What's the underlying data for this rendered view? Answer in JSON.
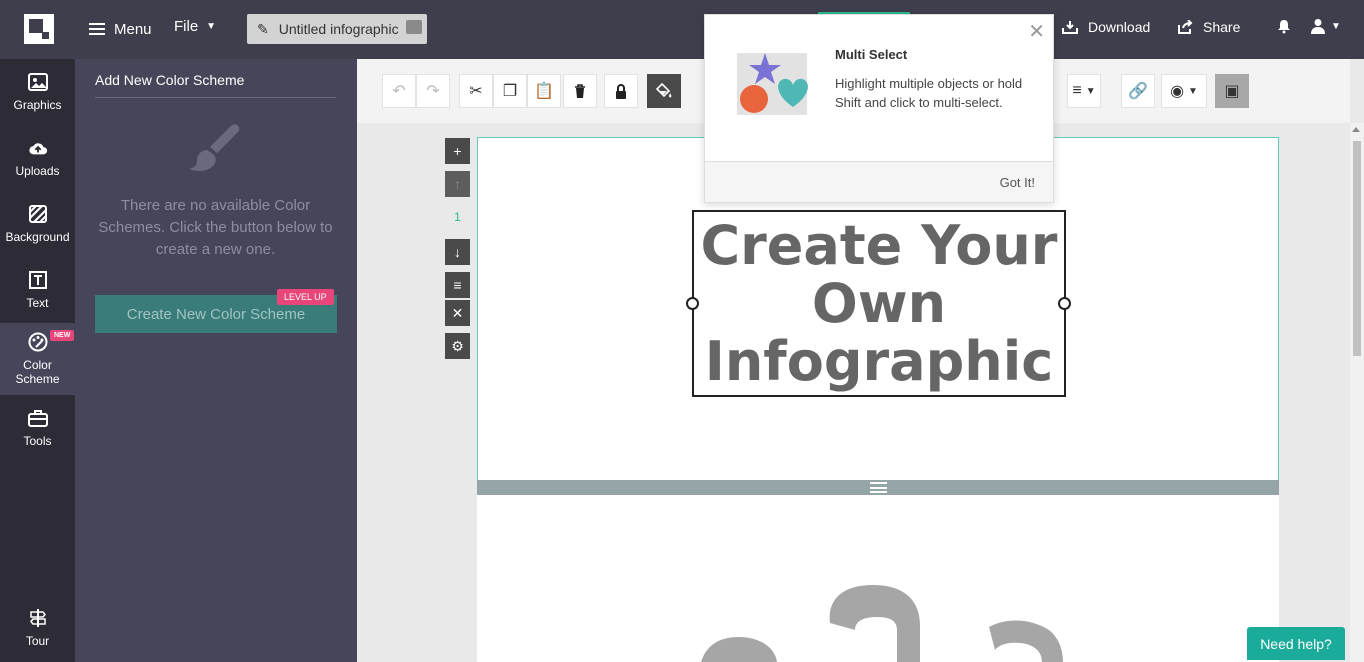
{
  "header": {
    "menu_label": "Menu",
    "file_label": "File",
    "doc_title": "Untitled infographic",
    "download_label": "Download",
    "share_label": "Share"
  },
  "sidebar": {
    "items": [
      {
        "label": "Graphics"
      },
      {
        "label": "Uploads"
      },
      {
        "label": "Background"
      },
      {
        "label": "Text"
      },
      {
        "label": "Color Scheme"
      },
      {
        "label": "Tools"
      }
    ],
    "new_badge": "NEW",
    "tour_label": "Tour"
  },
  "panel": {
    "title": "Add New Color Scheme",
    "empty_message": "There are no available Color Schemes. Click the button below to create a new one.",
    "create_button": "Create New Color Scheme",
    "level_up_badge": "LEVEL UP"
  },
  "canvas": {
    "page_number": "1",
    "headline_lines": [
      "Create Your",
      "Own",
      "Infographic"
    ]
  },
  "popup": {
    "title": "Multi Select",
    "description": "Highlight multiple objects or hold Shift and click to multi-select.",
    "got_it": "Got It!"
  },
  "help_button": "Need help?",
  "colors": {
    "topbar": "#3f3e4c",
    "rail": "#2c2b36",
    "panel": "#46455a",
    "accent_teal": "#1aab9b",
    "badge_pink": "#e8457a"
  }
}
